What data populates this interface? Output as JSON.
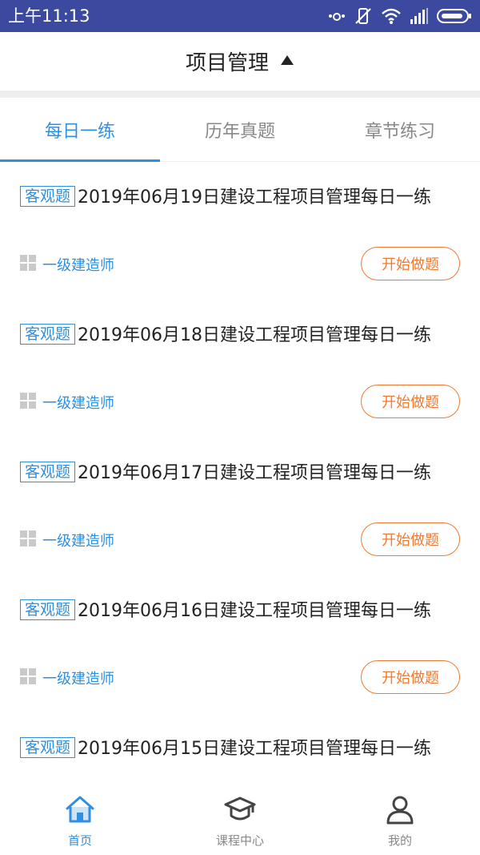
{
  "status_bar": {
    "time": "上午11:13",
    "icons": [
      "alarm-icon",
      "mute-icon",
      "wifi-icon",
      "signal-icon",
      "battery-icon"
    ]
  },
  "header": {
    "title": "项目管理",
    "dropdown_icon": "caret-up-icon"
  },
  "tabs": [
    {
      "label": "每日一练",
      "active": true
    },
    {
      "label": "历年真题",
      "active": false
    },
    {
      "label": "章节练习",
      "active": false
    }
  ],
  "items": [
    {
      "tag": "客观题",
      "title": "2019年06月19日建设工程项目管理每日一练",
      "category": "一级建造师",
      "button": "开始做题"
    },
    {
      "tag": "客观题",
      "title": "2019年06月18日建设工程项目管理每日一练",
      "category": "一级建造师",
      "button": "开始做题"
    },
    {
      "tag": "客观题",
      "title": "2019年06月17日建设工程项目管理每日一练",
      "category": "一级建造师",
      "button": "开始做题"
    },
    {
      "tag": "客观题",
      "title": "2019年06月16日建设工程项目管理每日一练",
      "category": "一级建造师",
      "button": "开始做题"
    },
    {
      "tag": "客观题",
      "title": "2019年06月15日建设工程项目管理每日一练",
      "category": "",
      "button": ""
    }
  ],
  "bottom_nav": [
    {
      "label": "首页",
      "icon": "home-icon",
      "active": true
    },
    {
      "label": "课程中心",
      "icon": "graduation-cap-icon",
      "active": false
    },
    {
      "label": "我的",
      "icon": "user-icon",
      "active": false
    }
  ],
  "colors": {
    "status_bar": "#3b4a9e",
    "accent": "#2f8fe0",
    "button": "#f07a30"
  }
}
